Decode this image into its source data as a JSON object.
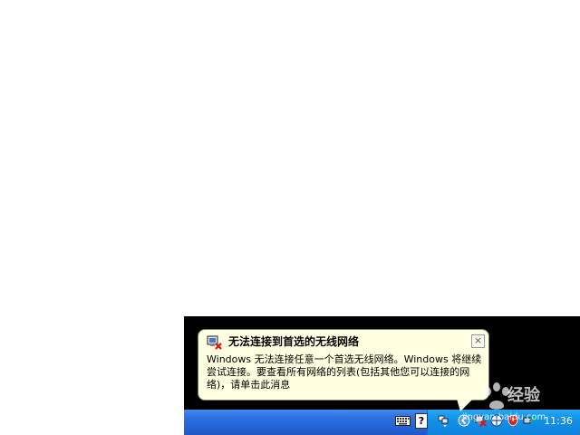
{
  "notification": {
    "title": "无法连接到首选的无线网络",
    "body": "Windows 无法连接任意一个首选无线网络。Windows 将继续尝试连接。要查看所有网络的列表(包括其他您可以连接的网络)，请单击此消息",
    "close_glyph": "×",
    "icon": "wireless-network-error-icon"
  },
  "taskbar": {
    "help_glyph": "?",
    "clock": "11:36"
  },
  "watermark": {
    "text": "经验",
    "sub": "jingyan.baidu.com"
  }
}
